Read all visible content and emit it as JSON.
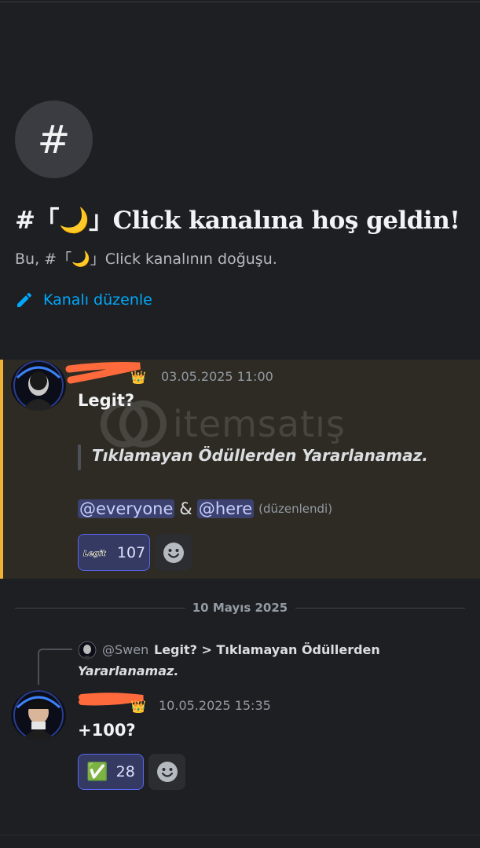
{
  "welcome": {
    "channel_icon": "#",
    "title": "#「🌙」Click kanalına hoş geldin!",
    "subtitle": "Bu, #「🌙」Click kanalının doğuşu.",
    "edit_label": "Kanalı düzenle"
  },
  "watermark": "itemsatış",
  "messages": [
    {
      "timestamp": "03.05.2025 11:00",
      "title": "Legit?",
      "quote": "Tıklamayan Ödüllerden Yararlanamaz.",
      "mention_everyone": "@everyone",
      "amp": "&",
      "mention_here": "@here",
      "edited": "(düzenlendi)",
      "reaction": {
        "emoji_label": "Legit",
        "count": "107"
      },
      "highlight_color": "#f0b232"
    },
    {
      "reply": {
        "user": "@Swen",
        "text": "Legit? > Tıklamayan Ödüllerden",
        "text_cont": "Yararlanamaz."
      },
      "timestamp": "10.05.2025 15:35",
      "text": "+100?",
      "reaction": {
        "emoji": "✅",
        "count": "28"
      }
    }
  ],
  "date_divider": "10 Mayıs 2025",
  "colors": {
    "link": "#00a8fc",
    "mention_bg": "#3c4270",
    "reaction_border": "#5865f2"
  }
}
